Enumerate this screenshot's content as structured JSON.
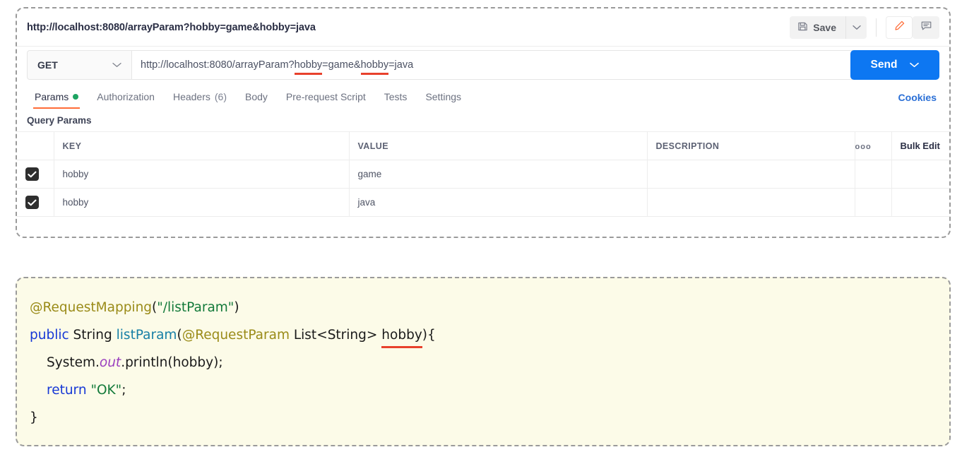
{
  "request": {
    "name": "http://localhost:8080/arrayParam?hobby=game&hobby=java",
    "save_label": "Save",
    "method": "GET",
    "url_prefix": "http://localhost:8080/arrayParam?",
    "url_key1": "hobby",
    "url_mid1": "=game&",
    "url_key2": "hobby",
    "url_suffix": "=java",
    "send_label": "Send"
  },
  "icons": {
    "save": "floppy-disk-icon",
    "save_caret": "chevron-down-icon",
    "edit": "pencil-icon",
    "comment": "comment-icon",
    "method_caret": "chevron-down-icon",
    "send_caret": "chevron-down-icon",
    "more": "three-dots-icon"
  },
  "tabs": [
    {
      "label": "Params",
      "active": true,
      "dot": true
    },
    {
      "label": "Authorization",
      "active": false
    },
    {
      "label": "Headers",
      "count": "(6)",
      "active": false
    },
    {
      "label": "Body",
      "active": false
    },
    {
      "label": "Pre-request Script",
      "active": false
    },
    {
      "label": "Tests",
      "active": false
    },
    {
      "label": "Settings",
      "active": false
    }
  ],
  "cookies_label": "Cookies",
  "params": {
    "section_title": "Query Params",
    "headers": {
      "key": "KEY",
      "value": "VALUE",
      "description": "DESCRIPTION",
      "dots": "ooo",
      "bulk_edit": "Bulk Edit"
    },
    "rows": [
      {
        "checked": true,
        "key": "hobby",
        "value": "game",
        "description": ""
      },
      {
        "checked": true,
        "key": "hobby",
        "value": "java",
        "description": ""
      }
    ]
  },
  "code": {
    "line1": {
      "annotation": "@RequestMapping",
      "paren_open": "(",
      "string": "\"/listParam\"",
      "paren_close": ")"
    },
    "line2": {
      "kw_public": "public",
      "type_string": " String ",
      "method_name": "listParam",
      "paren_open": "(",
      "annotation": "@RequestParam",
      "param_type": " List<String> ",
      "param_name": "hobby",
      "tail": "){"
    },
    "line3": {
      "prefix": "System.",
      "static_field": "out",
      "suffix": ".println(hobby);"
    },
    "line4": {
      "kw_return": "return",
      "space": " ",
      "string": "\"OK\"",
      "semi": ";"
    },
    "line5": "}"
  },
  "colors": {
    "postman_orange": "#ff6c37",
    "send_blue": "#0d77f2",
    "cookies_blue": "#2a6fd6",
    "dot_green": "#1da462",
    "underline_red": "#e8412c",
    "code_bg": "#fcfbe8"
  }
}
